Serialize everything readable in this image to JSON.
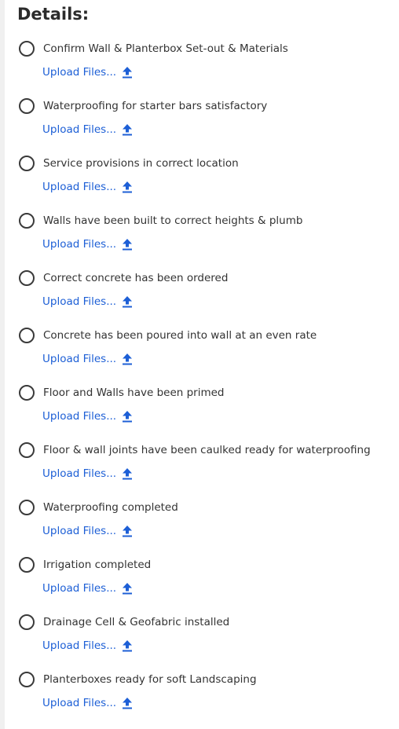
{
  "heading": "Details:",
  "upload_label": "Upload Files...",
  "accent_color": "#1d5fd6",
  "items": [
    {
      "label": "Confirm Wall & Planterbox Set-out & Materials"
    },
    {
      "label": "Waterproofing for starter bars satisfactory"
    },
    {
      "label": "Service provisions in correct location"
    },
    {
      "label": "Walls have been built to correct heights & plumb"
    },
    {
      "label": "Correct concrete has been ordered"
    },
    {
      "label": "Concrete has been poured into wall at an even rate"
    },
    {
      "label": "Floor and Walls have been primed"
    },
    {
      "label": "Floor & wall joints have been caulked ready for waterproofing"
    },
    {
      "label": "Waterproofing completed"
    },
    {
      "label": "Irrigation completed"
    },
    {
      "label": "Drainage Cell & Geofabric installed"
    },
    {
      "label": "Planterboxes ready for soft Landscaping"
    }
  ]
}
